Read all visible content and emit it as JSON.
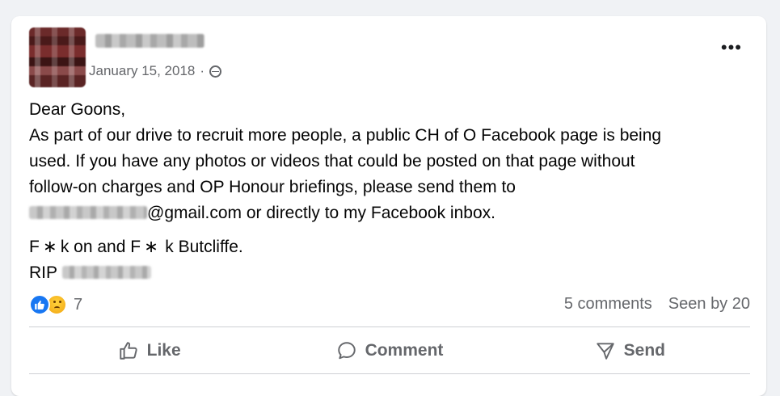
{
  "post": {
    "date": "January 15, 2018",
    "separator": "·",
    "more_label": "•••",
    "lines": [
      "Dear Goons,",
      "As part of our drive to recruit more people, a public CH of O Facebook page is being",
      "used. If you have any photos or videos that could be posted on that page without",
      "follow-on charges and OP Honour briefings, please send them to"
    ],
    "email_suffix": "@gmail.com or directly to my Facebook inbox.",
    "signoff": "F ∗ k on and F ∗  k Butcliffe.",
    "rip_label": "RIP"
  },
  "reactions": {
    "count": "7",
    "comments": "5 comments",
    "seen": "Seen by 20"
  },
  "actions": {
    "like": "Like",
    "comment": "Comment",
    "send": "Send"
  },
  "icons": [
    "globe-icon",
    "more-options-icon",
    "like-reaction-icon",
    "sad-reaction-icon",
    "thumbs-up-icon",
    "comment-bubble-icon",
    "send-icon"
  ],
  "colors": {
    "background": "#f0f2f5",
    "card": "#ffffff",
    "secondary_text": "#65676b",
    "like_blue": "#1877f2"
  }
}
